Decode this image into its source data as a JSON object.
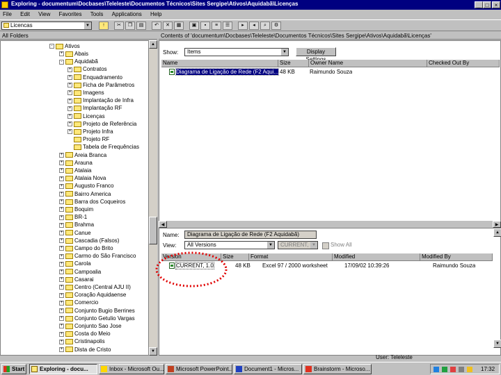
{
  "window": {
    "title": "Exploring - documentum\\Docbases\\Teleleste\\Documentos Técnicos\\Sites Sergipe\\Ativos\\Aquidabã\\Licenças",
    "controls": [
      "_",
      "□",
      "×"
    ]
  },
  "menu": [
    "File",
    "Edit",
    "View",
    "Favorites",
    "Tools",
    "Applications",
    "Help"
  ],
  "toolbar": {
    "address_value": "Licencas"
  },
  "left_header": "All Folders",
  "right_header": "Contents of 'documentum\\Docbases\\Teleleste\\Documentos Técnicos\\Sites Sergipe\\Ativos\\Aquidabã\\Licenças'",
  "tree": {
    "root": "Ativos",
    "items": [
      {
        "label": "Abais",
        "level": 1,
        "pm": "+"
      },
      {
        "label": "Aquidabã",
        "level": 1,
        "pm": "-"
      },
      {
        "label": "Contratos",
        "level": 2,
        "pm": "+"
      },
      {
        "label": "Enquadramento",
        "level": 2,
        "pm": "+"
      },
      {
        "label": "Ficha de Parâmetros",
        "level": 2,
        "pm": "+"
      },
      {
        "label": "Imagens",
        "level": 2,
        "pm": "+"
      },
      {
        "label": "Implantação de Infra",
        "level": 2,
        "pm": "+"
      },
      {
        "label": "Implantação RF",
        "level": 2,
        "pm": "+"
      },
      {
        "label": "Licenças",
        "level": 2,
        "pm": "+"
      },
      {
        "label": "Projeto de Referência",
        "level": 2,
        "pm": "+"
      },
      {
        "label": "Projeto Infra",
        "level": 2,
        "pm": "+"
      },
      {
        "label": "Projeto RF",
        "level": 2,
        "pm": ""
      },
      {
        "label": "Tabela de Frequências",
        "level": 2,
        "pm": ""
      },
      {
        "label": "Areia Branca",
        "level": 1,
        "pm": "+"
      },
      {
        "label": "Arauna",
        "level": 1,
        "pm": "+"
      },
      {
        "label": "Atalaia",
        "level": 1,
        "pm": "+"
      },
      {
        "label": "Atalaia Nova",
        "level": 1,
        "pm": "+"
      },
      {
        "label": "Augusto Franco",
        "level": 1,
        "pm": "+"
      },
      {
        "label": "Bairro America",
        "level": 1,
        "pm": "+"
      },
      {
        "label": "Barra dos Coqueiros",
        "level": 1,
        "pm": "+"
      },
      {
        "label": "Boquim",
        "level": 1,
        "pm": "+"
      },
      {
        "label": "BR-1",
        "level": 1,
        "pm": "+"
      },
      {
        "label": "Brahma",
        "level": 1,
        "pm": "+"
      },
      {
        "label": "Canue",
        "level": 1,
        "pm": "+"
      },
      {
        "label": "Cascadia (Falsos)",
        "level": 1,
        "pm": "+"
      },
      {
        "label": "Campo do Brito",
        "level": 1,
        "pm": "+"
      },
      {
        "label": "Carmo do São Francisco",
        "level": 1,
        "pm": "+"
      },
      {
        "label": "Carola",
        "level": 1,
        "pm": "+"
      },
      {
        "label": "Campoalia",
        "level": 1,
        "pm": "+"
      },
      {
        "label": "Casarai",
        "level": 1,
        "pm": "+"
      },
      {
        "label": "Centro (Central AJU II)",
        "level": 1,
        "pm": "+"
      },
      {
        "label": "Coração Aquidaense",
        "level": 1,
        "pm": "+"
      },
      {
        "label": "Comercio",
        "level": 1,
        "pm": "+"
      },
      {
        "label": "Conjunto Bugio Berrines",
        "level": 1,
        "pm": "+"
      },
      {
        "label": "Conjunto Getulio Vargas",
        "level": 1,
        "pm": "+"
      },
      {
        "label": "Conjunto Sao Jose",
        "level": 1,
        "pm": "+"
      },
      {
        "label": "Costa do Meio",
        "level": 1,
        "pm": "+"
      },
      {
        "label": "Cristinapolis",
        "level": 1,
        "pm": "+"
      },
      {
        "label": "Dista de Cristo",
        "level": 1,
        "pm": "+"
      }
    ]
  },
  "top_list": {
    "show_label": "Show:",
    "show_value": "Items",
    "display_button": "Display Settings",
    "columns": [
      "Name",
      "Size",
      "Owner Name",
      "Checked Out By"
    ],
    "rows": [
      {
        "name": "Diagrama de Ligação de Rede (F2 Aqui...",
        "size": "48 KB",
        "owner": "Raimundo Souza",
        "checked": ""
      }
    ]
  },
  "bottom_panel": {
    "name_label": "Name:",
    "name_value": "Diagrama de Ligação de Rede (F2 Aquidabã)",
    "view_label": "View:",
    "view_value": "All Versions",
    "version_value": "CURRENT, 1.0",
    "showall_label": "Show All",
    "columns": [
      "Version",
      "Size",
      "Format",
      "Modified",
      "Modified By"
    ],
    "rows": [
      {
        "version": "CURRENT, 1.0",
        "size": "48 KB",
        "format": "Excel 97 / 2000 worksheet",
        "modified": "17/09/02 10:39:26",
        "modby": "Raimundo Souza"
      }
    ]
  },
  "status": {
    "right": "User: Teleleste"
  },
  "taskbar": {
    "start": "Start",
    "tasks": [
      {
        "label": "Exploring - docu...",
        "active": true
      },
      {
        "label": "Inbox - Microsoft Ou...",
        "active": false
      },
      {
        "label": "Microsoft PowerPoint...",
        "active": false
      },
      {
        "label": "Document1 - Micros...",
        "active": false
      },
      {
        "label": "Brainstorm - Microso...",
        "active": false
      }
    ],
    "clock": "17:32"
  },
  "colors": {
    "title_bg": "#000080",
    "annotation": "#e00000",
    "folder": "#ffe87a"
  }
}
